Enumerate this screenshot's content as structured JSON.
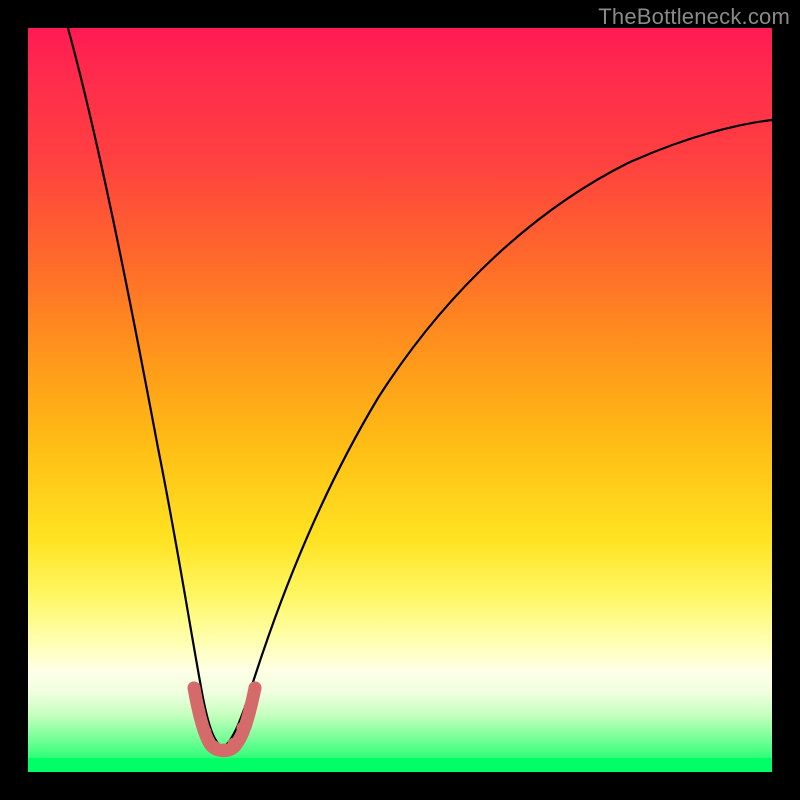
{
  "watermark": "TheBottleneck.com",
  "chart_data": {
    "type": "line",
    "title": "",
    "xlabel": "",
    "ylabel": "",
    "xlim": [
      0,
      1
    ],
    "ylim": [
      0,
      1
    ],
    "series": [
      {
        "name": "bottleneck-curve",
        "x": [
          0.0,
          0.04,
          0.08,
          0.12,
          0.16,
          0.2,
          0.225,
          0.25,
          0.275,
          0.3,
          0.34,
          0.4,
          0.48,
          0.56,
          0.64,
          0.72,
          0.8,
          0.88,
          0.95,
          1.0
        ],
        "values": [
          1.0,
          0.86,
          0.72,
          0.56,
          0.39,
          0.2,
          0.08,
          0.02,
          0.02,
          0.07,
          0.2,
          0.37,
          0.52,
          0.62,
          0.7,
          0.76,
          0.8,
          0.84,
          0.86,
          0.87
        ]
      },
      {
        "name": "minimum-marker",
        "x": [
          0.225,
          0.23,
          0.24,
          0.25,
          0.255,
          0.26,
          0.265,
          0.27,
          0.275,
          0.28,
          0.285,
          0.295,
          0.3
        ],
        "values": [
          0.085,
          0.055,
          0.03,
          0.02,
          0.018,
          0.018,
          0.018,
          0.02,
          0.025,
          0.035,
          0.045,
          0.065,
          0.085
        ]
      }
    ],
    "colors": {
      "gradient_top": "#ff1a53",
      "gradient_mid": "#ffd020",
      "gradient_bottom": "#ffffff",
      "base_strip": "#00ff66",
      "curve": "#000000",
      "marker": "#d46a6a"
    }
  }
}
